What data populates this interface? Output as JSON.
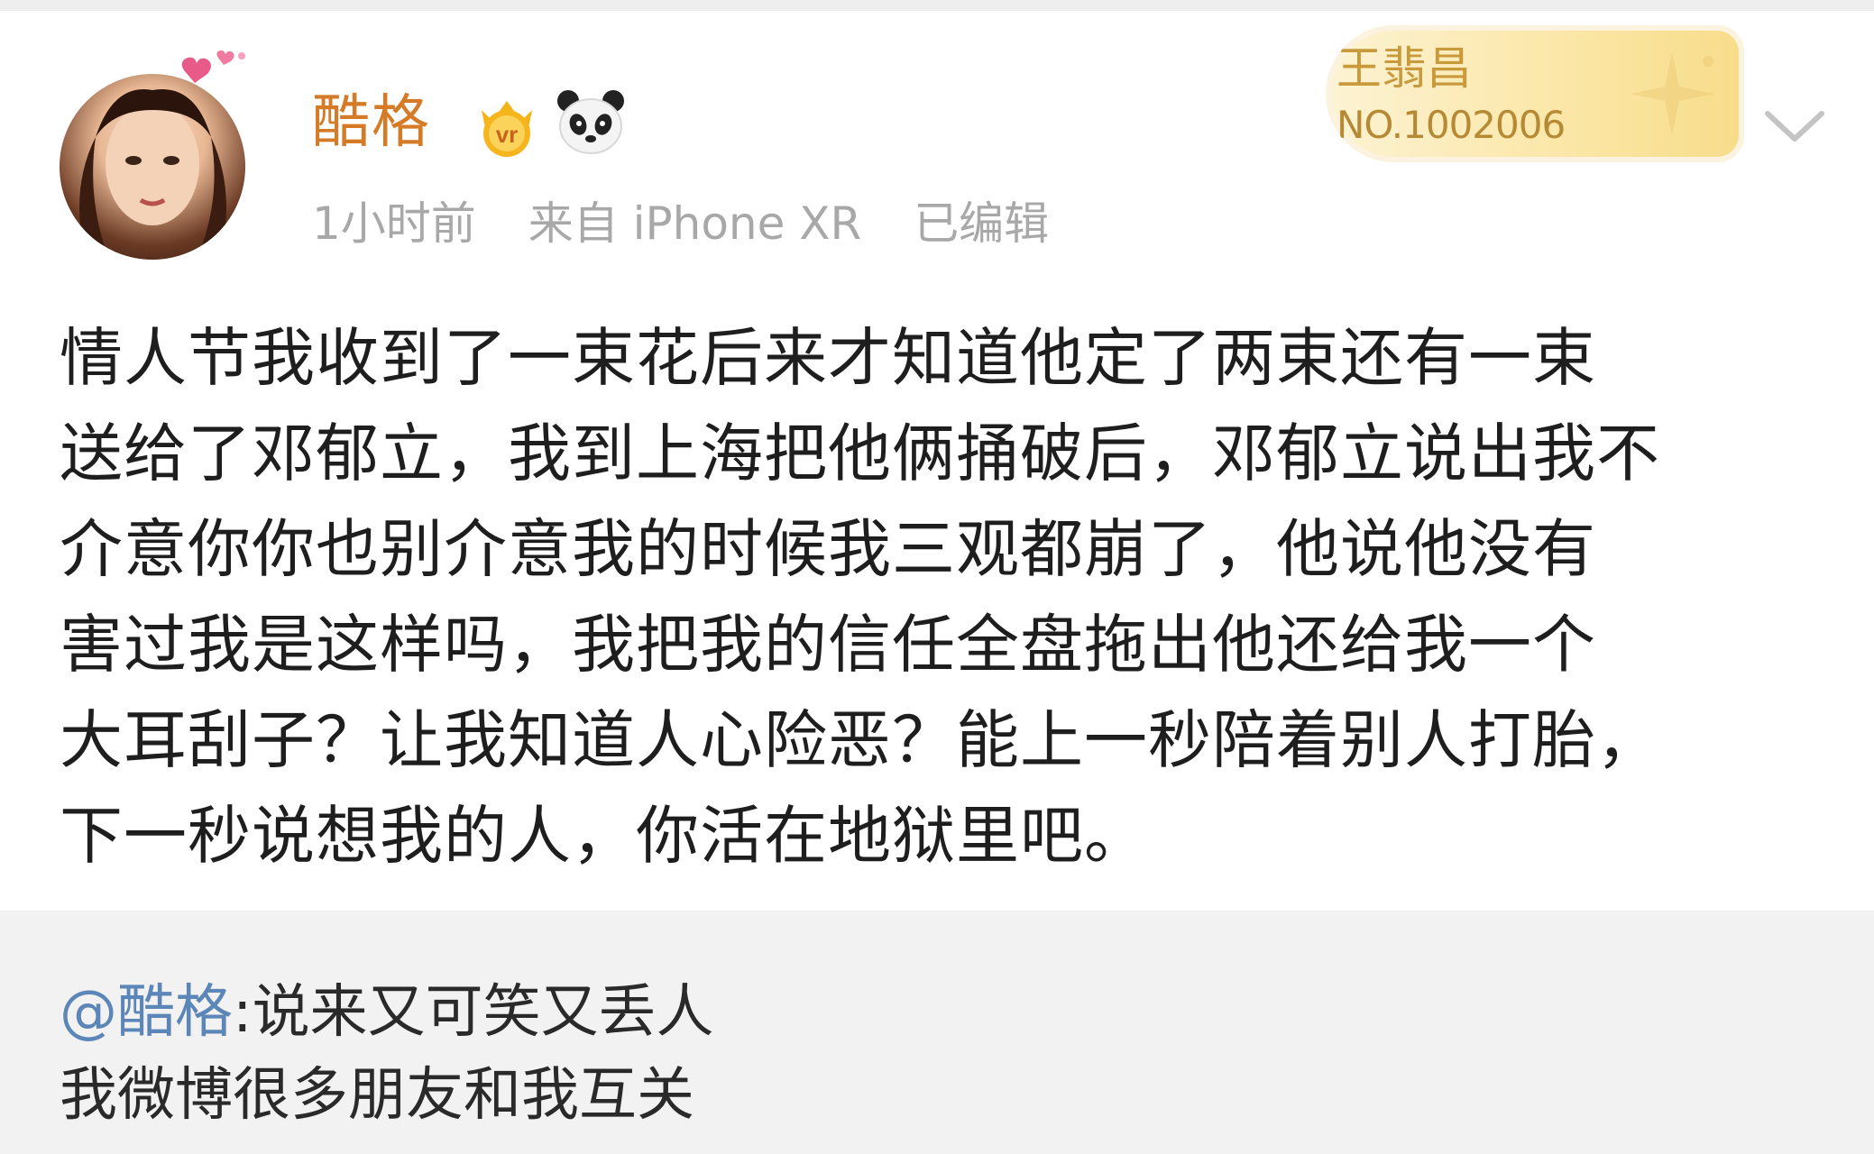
{
  "post": {
    "author": "酷格",
    "author_mention": "@酷格",
    "timestamp": "1小时前",
    "source": "来自 iPhone XR",
    "edited": "已编辑",
    "fan_card": {
      "name": "王翡昌",
      "number": "NO.1002006"
    },
    "lines": [
      "情人节我收到了一束花后来才知道他定了两束还有一束",
      "送给了邓郁立，我到上海把他俩捅破后，邓郁立说出我不",
      "介意你你也别介意我的时候我三观都崩了，他说他没有",
      "害过我是这样吗，我把我的信任全盘拖出他还给我一个",
      "大耳刮子？让我知道人心险恶？能上一秒陪着别人打胎，",
      "下一秒说想我的人，你活在地狱里吧。"
    ]
  },
  "repost": {
    "mention": "@酷格",
    "line1_rest": ":说来又可笑又丢人",
    "line2": "我微博很多朋友和我互关"
  },
  "icons": {
    "vip": "vip-crown-icon",
    "panda": "panda-icon",
    "chevron": "chevron-down-icon"
  },
  "colors": {
    "username": "#d57a26",
    "meta": "#a8a8a8",
    "mention": "#5d86b8",
    "repost_bg": "#f2f2f2"
  }
}
